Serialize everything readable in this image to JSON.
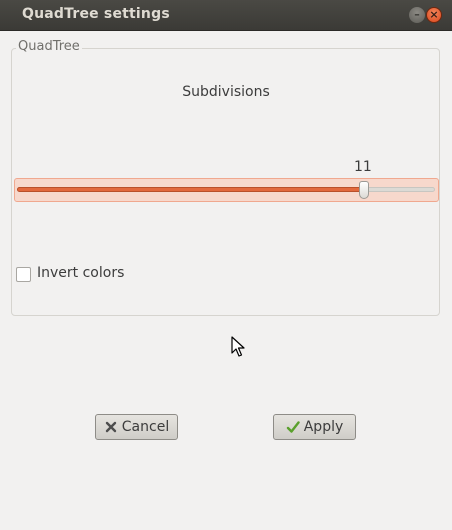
{
  "window": {
    "title": "QuadTree settings",
    "controls": [
      "minimize-icon",
      "close-icon"
    ]
  },
  "group": {
    "label": "QuadTree"
  },
  "slider": {
    "label": "Subdivisions",
    "value_text": "11",
    "value_fraction": 0.83
  },
  "checkbox": {
    "label": "Invert colors",
    "checked": false
  },
  "buttons": {
    "cancel_label": "Cancel",
    "apply_label": "Apply"
  },
  "colors": {
    "accent": "#e2683c",
    "titlebar": "#3c3b37",
    "close_button": "#e55b2e",
    "apply_check": "#5aa02c",
    "cancel_x": "#4d4d4d"
  }
}
